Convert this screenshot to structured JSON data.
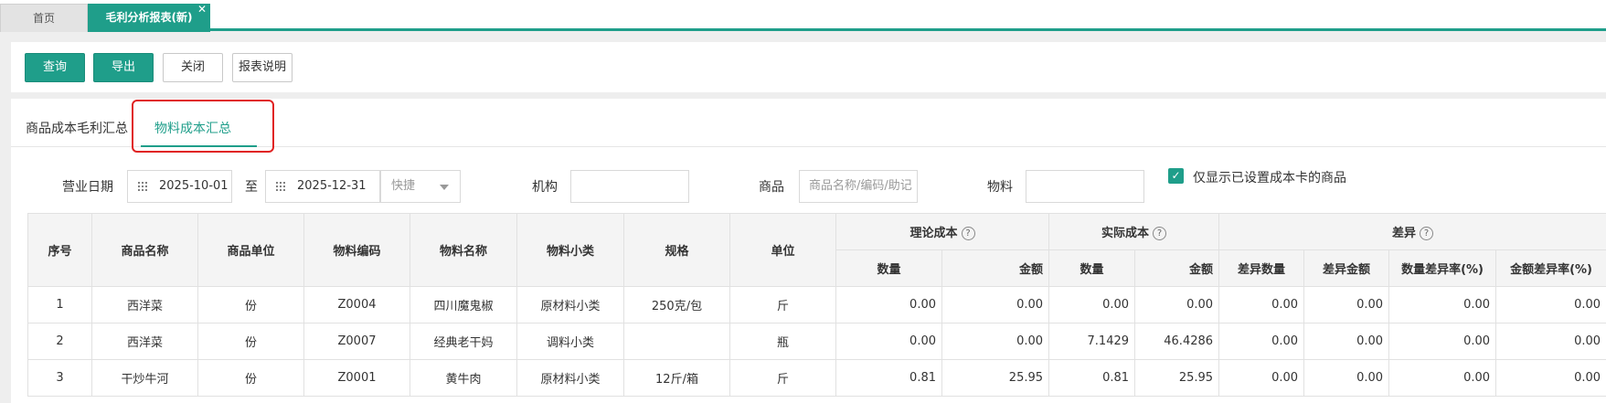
{
  "tabs": {
    "home": "首页",
    "active": "毛利分析报表(新)",
    "close": "✕"
  },
  "toolbar": {
    "query": "查询",
    "export": "导出",
    "close": "关闭",
    "report_help": "报表说明"
  },
  "subtabs": {
    "product_margin": "商品成本毛利汇总",
    "material_cost": "物料成本汇总"
  },
  "filters": {
    "date_label": "营业日期",
    "date_start": "2025-10-01",
    "date_to": "至",
    "date_end": "2025-12-31",
    "quick": "快捷",
    "org_label": "机构",
    "org_value": "",
    "product_label": "商品",
    "product_placeholder": "商品名称/编码/助记",
    "material_label": "物料",
    "material_value": "",
    "only_with_cost_card": "仅显示已设置成本卡的商品",
    "accent_color": "#1f9e8a"
  },
  "table": {
    "headers": {
      "seq": "序号",
      "product_name": "商品名称",
      "product_unit": "商品单位",
      "material_code": "物料编码",
      "material_name": "物料名称",
      "material_subclass": "物料小类",
      "spec": "规格",
      "unit": "单位",
      "theory_cost": "理论成本",
      "actual_cost": "实际成本",
      "diff": "差异",
      "qty": "数量",
      "amount": "金额",
      "diff_qty": "差异数量",
      "diff_amount": "差异金额",
      "qty_diff_rate": "数量差异率(%)",
      "amount_diff_rate": "金额差异率(%)"
    },
    "rows": [
      {
        "seq": "1",
        "product_name": "西洋菜",
        "product_unit": "份",
        "material_code": "Z0004",
        "material_name": "四川魔鬼椒",
        "material_subclass": "原材料小类",
        "spec": "250克/包",
        "unit": "斤",
        "theory_qty": "0.00",
        "theory_amount": "0.00",
        "actual_qty": "0.00",
        "actual_amount": "0.00",
        "diff_qty": "0.00",
        "diff_amount": "0.00",
        "qty_diff_rate": "0.00",
        "amount_diff_rate": "0.00"
      },
      {
        "seq": "2",
        "product_name": "西洋菜",
        "product_unit": "份",
        "material_code": "Z0007",
        "material_name": "经典老干妈",
        "material_subclass": "调料小类",
        "spec": "",
        "unit": "瓶",
        "theory_qty": "0.00",
        "theory_amount": "0.00",
        "actual_qty": "7.1429",
        "actual_amount": "46.4286",
        "diff_qty": "0.00",
        "diff_amount": "0.00",
        "qty_diff_rate": "0.00",
        "amount_diff_rate": "0.00"
      },
      {
        "seq": "3",
        "product_name": "干炒牛河",
        "product_unit": "份",
        "material_code": "Z0001",
        "material_name": "黄牛肉",
        "material_subclass": "原材料小类",
        "spec": "12斤/箱",
        "unit": "斤",
        "theory_qty": "0.81",
        "theory_amount": "25.95",
        "actual_qty": "0.81",
        "actual_amount": "25.95",
        "diff_qty": "0.00",
        "diff_amount": "0.00",
        "qty_diff_rate": "0.00",
        "amount_diff_rate": "0.00"
      }
    ]
  }
}
